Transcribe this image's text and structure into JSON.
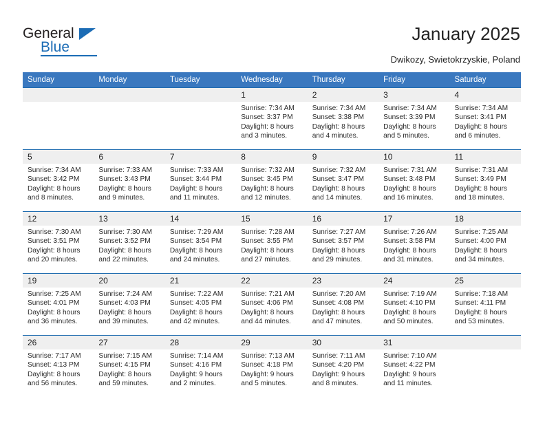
{
  "brand": {
    "name_part1": "General",
    "name_part2": "Blue",
    "accent_color": "#1b6cb5"
  },
  "header": {
    "title": "January 2025",
    "subtitle": "Dwikozy, Swietokrzyskie, Poland"
  },
  "calendar": {
    "header_bg": "#3a78bf",
    "row_border_color": "#1f6cb0",
    "daynum_bg": "#efefef",
    "weekdays": [
      "Sunday",
      "Monday",
      "Tuesday",
      "Wednesday",
      "Thursday",
      "Friday",
      "Saturday"
    ],
    "weeks": [
      [
        {
          "day": "",
          "empty": true
        },
        {
          "day": "",
          "empty": true
        },
        {
          "day": "",
          "empty": true
        },
        {
          "day": "1",
          "sunrise": "Sunrise: 7:34 AM",
          "sunset": "Sunset: 3:37 PM",
          "daylight": "Daylight: 8 hours and 3 minutes."
        },
        {
          "day": "2",
          "sunrise": "Sunrise: 7:34 AM",
          "sunset": "Sunset: 3:38 PM",
          "daylight": "Daylight: 8 hours and 4 minutes."
        },
        {
          "day": "3",
          "sunrise": "Sunrise: 7:34 AM",
          "sunset": "Sunset: 3:39 PM",
          "daylight": "Daylight: 8 hours and 5 minutes."
        },
        {
          "day": "4",
          "sunrise": "Sunrise: 7:34 AM",
          "sunset": "Sunset: 3:41 PM",
          "daylight": "Daylight: 8 hours and 6 minutes."
        }
      ],
      [
        {
          "day": "5",
          "sunrise": "Sunrise: 7:34 AM",
          "sunset": "Sunset: 3:42 PM",
          "daylight": "Daylight: 8 hours and 8 minutes."
        },
        {
          "day": "6",
          "sunrise": "Sunrise: 7:33 AM",
          "sunset": "Sunset: 3:43 PM",
          "daylight": "Daylight: 8 hours and 9 minutes."
        },
        {
          "day": "7",
          "sunrise": "Sunrise: 7:33 AM",
          "sunset": "Sunset: 3:44 PM",
          "daylight": "Daylight: 8 hours and 11 minutes."
        },
        {
          "day": "8",
          "sunrise": "Sunrise: 7:32 AM",
          "sunset": "Sunset: 3:45 PM",
          "daylight": "Daylight: 8 hours and 12 minutes."
        },
        {
          "day": "9",
          "sunrise": "Sunrise: 7:32 AM",
          "sunset": "Sunset: 3:47 PM",
          "daylight": "Daylight: 8 hours and 14 minutes."
        },
        {
          "day": "10",
          "sunrise": "Sunrise: 7:31 AM",
          "sunset": "Sunset: 3:48 PM",
          "daylight": "Daylight: 8 hours and 16 minutes."
        },
        {
          "day": "11",
          "sunrise": "Sunrise: 7:31 AM",
          "sunset": "Sunset: 3:49 PM",
          "daylight": "Daylight: 8 hours and 18 minutes."
        }
      ],
      [
        {
          "day": "12",
          "sunrise": "Sunrise: 7:30 AM",
          "sunset": "Sunset: 3:51 PM",
          "daylight": "Daylight: 8 hours and 20 minutes."
        },
        {
          "day": "13",
          "sunrise": "Sunrise: 7:30 AM",
          "sunset": "Sunset: 3:52 PM",
          "daylight": "Daylight: 8 hours and 22 minutes."
        },
        {
          "day": "14",
          "sunrise": "Sunrise: 7:29 AM",
          "sunset": "Sunset: 3:54 PM",
          "daylight": "Daylight: 8 hours and 24 minutes."
        },
        {
          "day": "15",
          "sunrise": "Sunrise: 7:28 AM",
          "sunset": "Sunset: 3:55 PM",
          "daylight": "Daylight: 8 hours and 27 minutes."
        },
        {
          "day": "16",
          "sunrise": "Sunrise: 7:27 AM",
          "sunset": "Sunset: 3:57 PM",
          "daylight": "Daylight: 8 hours and 29 minutes."
        },
        {
          "day": "17",
          "sunrise": "Sunrise: 7:26 AM",
          "sunset": "Sunset: 3:58 PM",
          "daylight": "Daylight: 8 hours and 31 minutes."
        },
        {
          "day": "18",
          "sunrise": "Sunrise: 7:25 AM",
          "sunset": "Sunset: 4:00 PM",
          "daylight": "Daylight: 8 hours and 34 minutes."
        }
      ],
      [
        {
          "day": "19",
          "sunrise": "Sunrise: 7:25 AM",
          "sunset": "Sunset: 4:01 PM",
          "daylight": "Daylight: 8 hours and 36 minutes."
        },
        {
          "day": "20",
          "sunrise": "Sunrise: 7:24 AM",
          "sunset": "Sunset: 4:03 PM",
          "daylight": "Daylight: 8 hours and 39 minutes."
        },
        {
          "day": "21",
          "sunrise": "Sunrise: 7:22 AM",
          "sunset": "Sunset: 4:05 PM",
          "daylight": "Daylight: 8 hours and 42 minutes."
        },
        {
          "day": "22",
          "sunrise": "Sunrise: 7:21 AM",
          "sunset": "Sunset: 4:06 PM",
          "daylight": "Daylight: 8 hours and 44 minutes."
        },
        {
          "day": "23",
          "sunrise": "Sunrise: 7:20 AM",
          "sunset": "Sunset: 4:08 PM",
          "daylight": "Daylight: 8 hours and 47 minutes."
        },
        {
          "day": "24",
          "sunrise": "Sunrise: 7:19 AM",
          "sunset": "Sunset: 4:10 PM",
          "daylight": "Daylight: 8 hours and 50 minutes."
        },
        {
          "day": "25",
          "sunrise": "Sunrise: 7:18 AM",
          "sunset": "Sunset: 4:11 PM",
          "daylight": "Daylight: 8 hours and 53 minutes."
        }
      ],
      [
        {
          "day": "26",
          "sunrise": "Sunrise: 7:17 AM",
          "sunset": "Sunset: 4:13 PM",
          "daylight": "Daylight: 8 hours and 56 minutes."
        },
        {
          "day": "27",
          "sunrise": "Sunrise: 7:15 AM",
          "sunset": "Sunset: 4:15 PM",
          "daylight": "Daylight: 8 hours and 59 minutes."
        },
        {
          "day": "28",
          "sunrise": "Sunrise: 7:14 AM",
          "sunset": "Sunset: 4:16 PM",
          "daylight": "Daylight: 9 hours and 2 minutes."
        },
        {
          "day": "29",
          "sunrise": "Sunrise: 7:13 AM",
          "sunset": "Sunset: 4:18 PM",
          "daylight": "Daylight: 9 hours and 5 minutes."
        },
        {
          "day": "30",
          "sunrise": "Sunrise: 7:11 AM",
          "sunset": "Sunset: 4:20 PM",
          "daylight": "Daylight: 9 hours and 8 minutes."
        },
        {
          "day": "31",
          "sunrise": "Sunrise: 7:10 AM",
          "sunset": "Sunset: 4:22 PM",
          "daylight": "Daylight: 9 hours and 11 minutes."
        },
        {
          "day": "",
          "empty": true
        }
      ]
    ]
  }
}
